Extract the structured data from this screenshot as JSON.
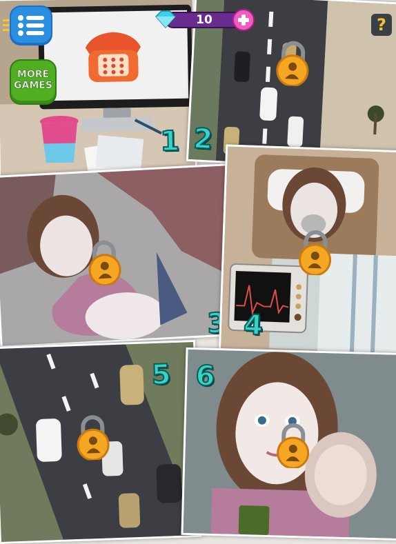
{
  "hud": {
    "gem_count": "10",
    "more_games_line1": "MORE",
    "more_games_line2": "GAMES",
    "help_label": "?"
  },
  "levels": [
    {
      "number": "1",
      "locked": false,
      "scene": "desk-phone"
    },
    {
      "number": "2",
      "locked": true,
      "scene": "ambulance-road"
    },
    {
      "number": "3",
      "locked": true,
      "scene": "accident"
    },
    {
      "number": "4",
      "locked": true,
      "scene": "ambulance-oxygen"
    },
    {
      "number": "5",
      "locked": true,
      "scene": "highway"
    },
    {
      "number": "6",
      "locked": true,
      "scene": "mother-baby"
    }
  ],
  "colors": {
    "level_number": "#35d4c8",
    "lock_gold": "#f5a623",
    "menu_blue": "#2a8fe0",
    "more_games_green": "#5bc12e",
    "gem_bar_purple": "#6a2b8e"
  }
}
